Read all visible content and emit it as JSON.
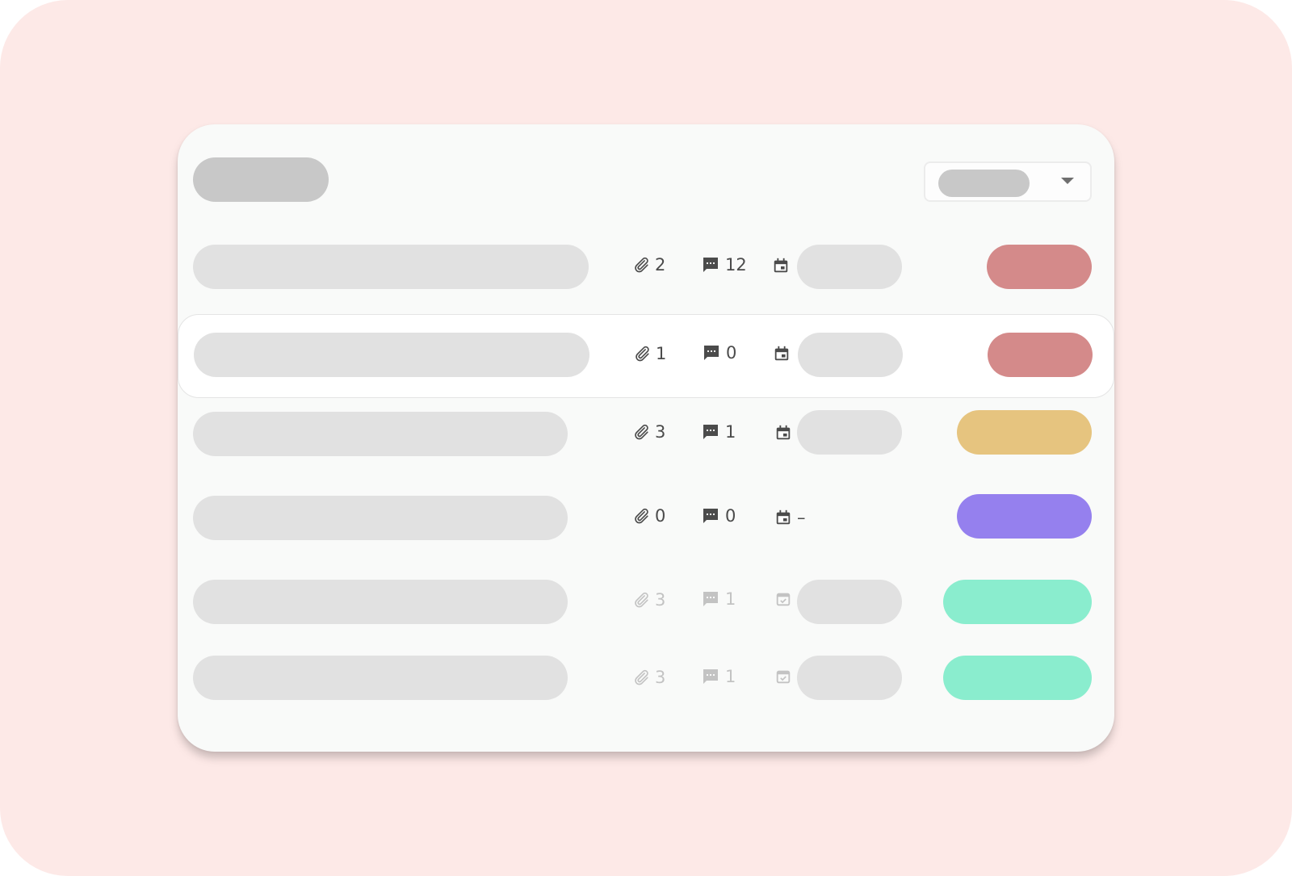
{
  "colors": {
    "backdrop": "#fde9e7",
    "card": "#f9faf9",
    "skeleton_dark": "#c8c8c8",
    "skeleton_light": "#e1e1e1",
    "status_red": "#d48a8a",
    "status_yellow": "#e6c47f",
    "status_purple": "#9580ee",
    "status_green": "#8aedce"
  },
  "header": {
    "filter_dropdown": {
      "icon": "chevron-down-icon"
    }
  },
  "rows": [
    {
      "attachments": "2",
      "comments": "12",
      "due_date": "",
      "status_color": "#d48a8a",
      "highlighted": false,
      "dim": false,
      "date_icon": "calendar-event-icon"
    },
    {
      "attachments": "1",
      "comments": "0",
      "due_date": "",
      "status_color": "#d48a8a",
      "highlighted": true,
      "dim": false,
      "date_icon": "calendar-event-icon"
    },
    {
      "attachments": "3",
      "comments": "1",
      "due_date": "",
      "status_color": "#e6c47f",
      "highlighted": false,
      "dim": false,
      "date_icon": "calendar-event-icon"
    },
    {
      "attachments": "0",
      "comments": "0",
      "due_date": "–",
      "status_color": "#9580ee",
      "highlighted": false,
      "dim": false,
      "date_icon": "calendar-event-icon"
    },
    {
      "attachments": "3",
      "comments": "1",
      "due_date": "",
      "status_color": "#8aedce",
      "highlighted": false,
      "dim": true,
      "date_icon": "calendar-check-icon"
    },
    {
      "attachments": "3",
      "comments": "1",
      "due_date": "",
      "status_color": "#8aedce",
      "highlighted": false,
      "dim": true,
      "date_icon": "calendar-check-icon"
    }
  ],
  "icons": {
    "attachment": "paperclip-icon",
    "comment": "comment-icon"
  }
}
